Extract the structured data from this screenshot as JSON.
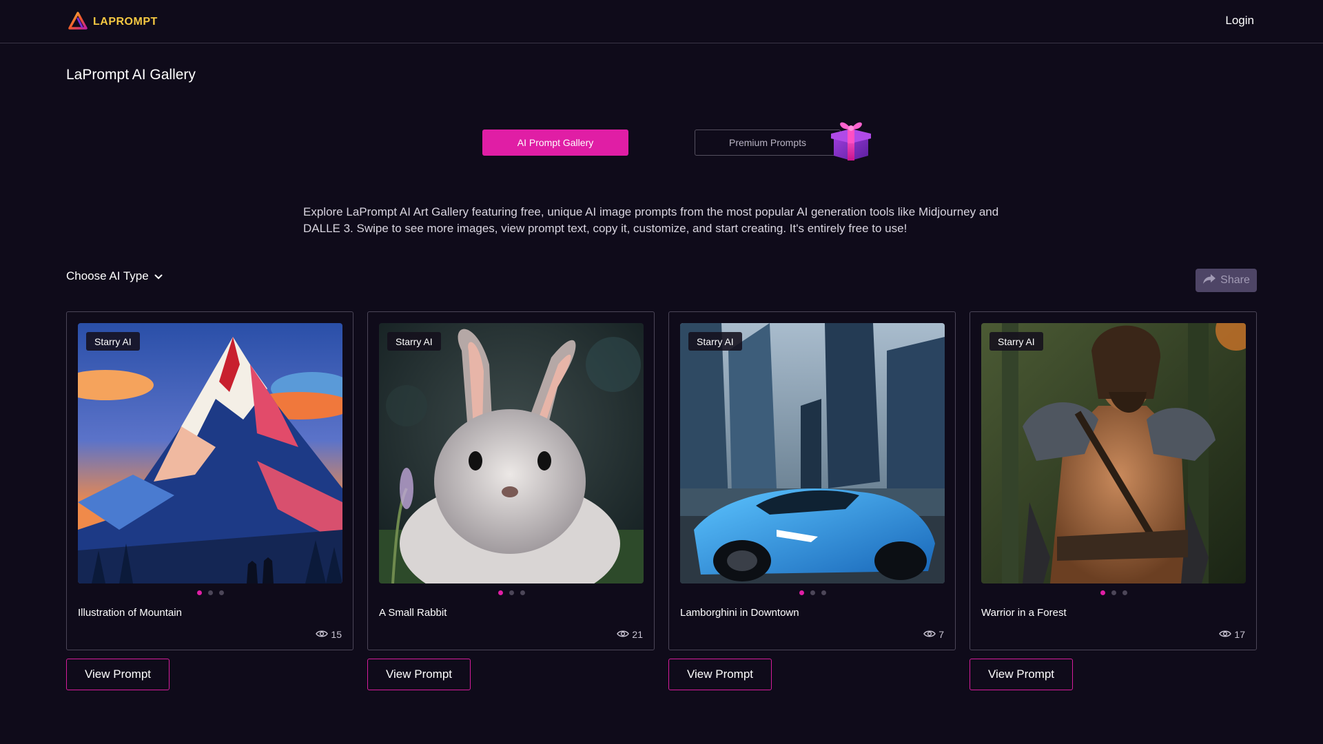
{
  "header": {
    "logo_text": "LAPROMPT",
    "logo_icon": "triangle-logo-icon",
    "login_label": "Login"
  },
  "page": {
    "title": "LaPrompt AI Gallery",
    "description": "Explore LaPrompt AI Art Gallery featuring free, unique AI image prompts from the most popular AI generation tools like Midjourney and DALLE 3. Swipe to see more images, view prompt text, copy it, customize, and start creating. It's entirely free to use!"
  },
  "tabs": {
    "gallery_label": "AI Prompt Gallery",
    "premium_label": "Premium Prompts",
    "gallery_active": true
  },
  "filter": {
    "choose_type_label": "Choose AI Type",
    "share_label": "Share"
  },
  "cards": [
    {
      "badge": "Starry AI",
      "title": "Illustration of Mountain",
      "views": "15",
      "button": "View Prompt",
      "active_dot": 0,
      "dot_count": 3,
      "image": "mountain-illustration"
    },
    {
      "badge": "Starry AI",
      "title": "A Small Rabbit",
      "views": "21",
      "button": "View Prompt",
      "active_dot": 0,
      "dot_count": 3,
      "image": "rabbit-photo"
    },
    {
      "badge": "Starry AI",
      "title": "Lamborghini in Downtown",
      "views": "7",
      "button": "View Prompt",
      "active_dot": 0,
      "dot_count": 3,
      "image": "lamborghini-photo"
    },
    {
      "badge": "Starry AI",
      "title": "Warrior in a Forest",
      "views": "17",
      "button": "View Prompt",
      "active_dot": 0,
      "dot_count": 3,
      "image": "warrior-photo"
    }
  ],
  "colors": {
    "background": "#0f0b1a",
    "accent": "#e01ea5",
    "logo_text": "#f5c842",
    "card_border": "#4c4658",
    "share_bg": "#4e4566"
  }
}
